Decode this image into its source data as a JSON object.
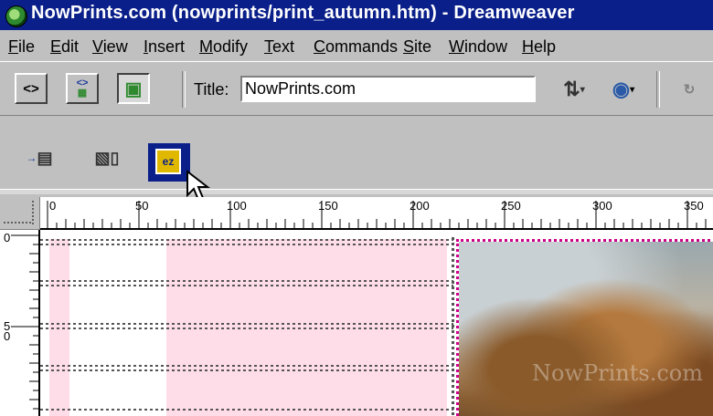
{
  "window": {
    "title": "NowPrints.com (nowprints/print_autumn.htm) - Dreamweaver",
    "title_bar_color": "#0a1f8a"
  },
  "menu": [
    "File",
    "Edit",
    "View",
    "Insert",
    "Modify",
    "Text",
    "Commands",
    "Site",
    "Window",
    "Help"
  ],
  "toolbar": {
    "view_buttons": [
      {
        "name": "code-view-icon",
        "glyph": "<>"
      },
      {
        "name": "code-design-view-icon",
        "glyph": "<>"
      },
      {
        "name": "design-view-icon",
        "glyph": "▣"
      }
    ],
    "title_label": "Title:",
    "title_value": "NowPrints.com",
    "file_management_icon": "file-management-icon",
    "browser_preview_icon": "preview-in-browser-icon",
    "refresh_icon": "refresh-icon"
  },
  "objects_bar": {
    "items": [
      "insert-table-icon",
      "insert-image-icon",
      "ez-object-icon"
    ],
    "ez_label": "ez"
  },
  "ruler": {
    "h_labels": [
      "0",
      "50",
      "100",
      "150",
      "200",
      "250",
      "300",
      "350"
    ],
    "v_labels": [
      "0",
      "5\n0"
    ]
  },
  "canvas": {
    "guide_color": "#cc0088",
    "cell_pink": "#ffdde8",
    "watermark": "NowPrints.com"
  }
}
